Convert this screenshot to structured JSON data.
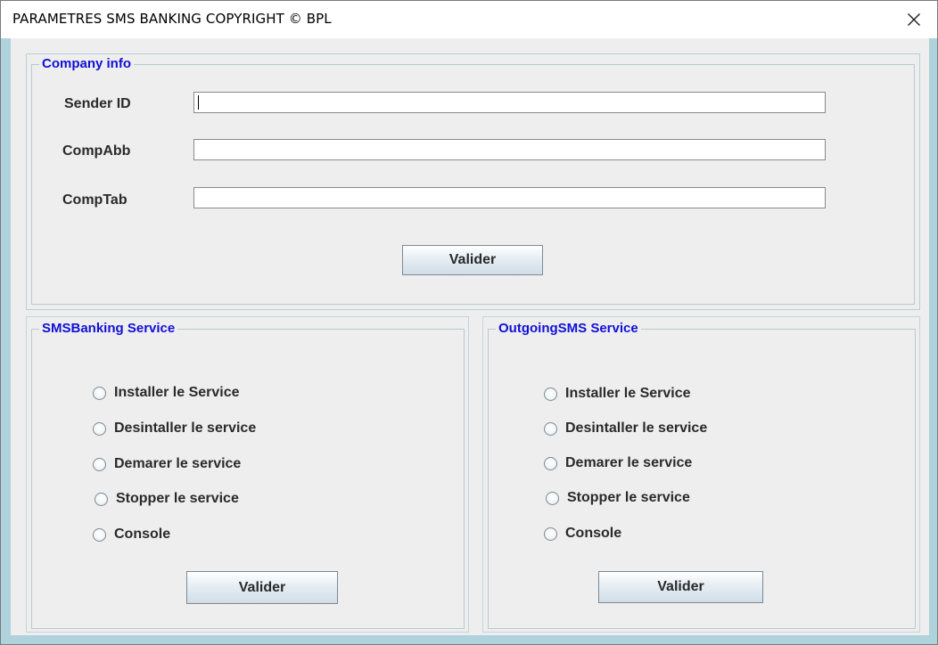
{
  "window": {
    "title": "PARAMETRES SMS BANKING COPYRIGHT © BPL",
    "close_icon": "close-icon"
  },
  "company_info": {
    "legend": "Company info",
    "fields": [
      {
        "label": "Sender ID",
        "value": ""
      },
      {
        "label": "CompAbb",
        "value": ""
      },
      {
        "label": "CompTab",
        "value": ""
      }
    ],
    "submit_label": "Valider"
  },
  "smsbanking_service": {
    "legend": "SMSBanking Service",
    "options": [
      {
        "label": "Installer le Service",
        "selected": false
      },
      {
        "label": "Desintaller le service",
        "selected": false
      },
      {
        "label": "Demarer le service",
        "selected": false
      },
      {
        "label": "Stopper le service",
        "selected": false
      },
      {
        "label": "Console",
        "selected": false
      }
    ],
    "submit_label": "Valider"
  },
  "outgoingsms_service": {
    "legend": "OutgoingSMS Service",
    "options": [
      {
        "label": "Installer le Service",
        "selected": false
      },
      {
        "label": "Desintaller le service",
        "selected": false
      },
      {
        "label": "Demarer le service",
        "selected": false
      },
      {
        "label": "Stopper le service",
        "selected": false
      },
      {
        "label": "Console",
        "selected": false
      }
    ],
    "submit_label": "Valider"
  },
  "colors": {
    "legend_text": "#1010d8",
    "window_frame": "#afd3dc",
    "panel_background": "#eeeeee"
  }
}
